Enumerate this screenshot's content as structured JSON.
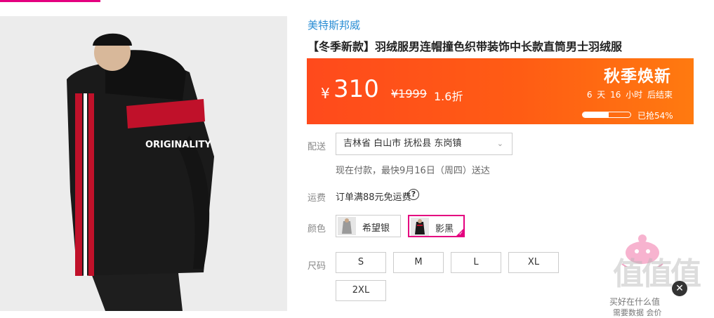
{
  "brand": "美特斯邦威",
  "product_title": "【冬季新款】羽绒服男连帽撞色织带装饰中长款直筒男士羽绒服",
  "price": {
    "currency": "¥",
    "current": "310",
    "original": "¥1999",
    "discount": "1.6折",
    "promo_title": "秋季焕新",
    "countdown": "6 天 16 小时 后结束",
    "sold_label": "已抢54%",
    "sold_fraction": 0.54
  },
  "delivery": {
    "label": "配送",
    "address": "吉林省 白山市 抚松县 东岗镇",
    "note": "现在付款，最快9月16日（周四）送达"
  },
  "shipping": {
    "label": "运费",
    "text": "订单满88元免运费",
    "help_glyph": "?"
  },
  "color": {
    "label": "颜色",
    "options": [
      {
        "name": "希望银",
        "selected": false
      },
      {
        "name": "影黑",
        "selected": true
      }
    ]
  },
  "size": {
    "label": "尺码",
    "options": [
      "S",
      "M",
      "L",
      "XL",
      "2XL"
    ]
  },
  "image": {
    "jacket_print": "ORIGINALITY",
    "zoom_glyph": "🔍"
  },
  "overlay": {
    "watermark": "值值值",
    "close_glyph": "✕",
    "line1": "买好在什么值",
    "line2": "需要数据 会价"
  },
  "icons": {
    "dropdown": "chevron-down-icon",
    "help": "question-circle-icon",
    "zoom": "magnifier-icon",
    "close": "close-icon"
  },
  "colors": {
    "accent": "#e4007f",
    "banner_start": "#ff4a1c",
    "banner_end": "#ff7a10",
    "brand_link": "#2a8dd4"
  }
}
